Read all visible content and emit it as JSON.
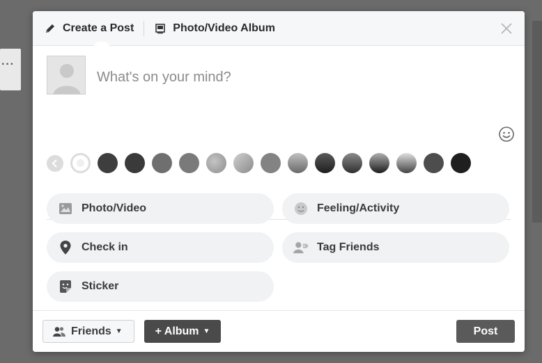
{
  "dialog": {
    "tabs": [
      {
        "label": "Create a Post",
        "icon": "pencil-icon"
      },
      {
        "label": "Photo/Video Album",
        "icon": "album-icon"
      }
    ],
    "close_icon": "close-icon"
  },
  "composer": {
    "placeholder": "What's on your mind?",
    "emoji_icon": "smiley-icon"
  },
  "swatches": {
    "colors": [
      "#ffffff",
      "#3e3e3e",
      "#3a3a3a",
      "#6f6f6f",
      "#7a7a7a",
      "#9a9a9a",
      "#b4b4b4",
      "#838383",
      "#8e8e8e",
      "#2e2e2e",
      "#4a4a4a",
      "#2a2a2a",
      "#6a6a6a",
      "#4d4d4d",
      "#1f1f1f"
    ]
  },
  "actions": [
    {
      "label": "Photo/Video",
      "icon": "photo-icon"
    },
    {
      "label": "Feeling/Activity",
      "icon": "feeling-icon"
    },
    {
      "label": "Check in",
      "icon": "location-pin-icon"
    },
    {
      "label": "Tag Friends",
      "icon": "tag-friends-icon"
    },
    {
      "label": "Sticker",
      "icon": "sticker-icon"
    }
  ],
  "footer": {
    "audience_label": "Friends",
    "album_label": "+ Album",
    "post_label": "Post"
  }
}
